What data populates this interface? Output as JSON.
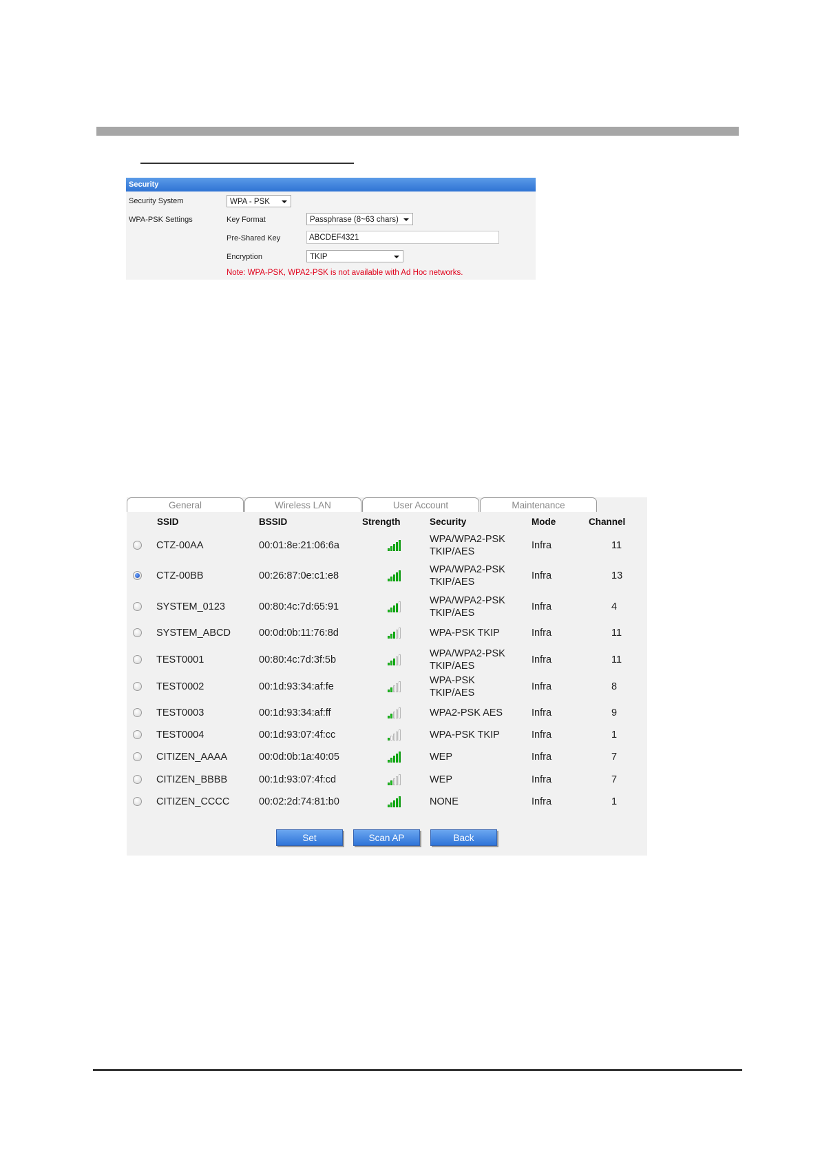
{
  "security": {
    "header": "Security",
    "security_system_label": "Security System",
    "security_system_value": "WPA - PSK",
    "wpa_psk_settings_label": "WPA-PSK Settings",
    "key_format_label": "Key Format",
    "key_format_value": "Passphrase (8~63 chars)",
    "pre_shared_key_label": "Pre-Shared Key",
    "pre_shared_key_value": "ABCDEF4321",
    "encryption_label": "Encryption",
    "encryption_value": "TKIP",
    "note": "Note: WPA-PSK, WPA2-PSK is not available with Ad Hoc networks."
  },
  "tabs": [
    "General",
    "Wireless LAN",
    "User Account",
    "Maintenance"
  ],
  "columns": {
    "ssid": "SSID",
    "bssid": "BSSID",
    "strength": "Strength",
    "security": "Security",
    "mode": "Mode",
    "channel": "Channel"
  },
  "access_points": [
    {
      "ssid": "CTZ-00AA",
      "bssid": "00:01:8e:21:06:6a",
      "strength": 5,
      "security_line1": "WPA/WPA2-PSK",
      "security_line2": "TKIP/AES",
      "mode": "Infra",
      "channel": "11",
      "selected": false
    },
    {
      "ssid": "CTZ-00BB",
      "bssid": "00:26:87:0e:c1:e8",
      "strength": 5,
      "security_line1": "WPA/WPA2-PSK",
      "security_line2": "TKIP/AES",
      "mode": "Infra",
      "channel": "13",
      "selected": true
    },
    {
      "ssid": "SYSTEM_0123",
      "bssid": "00:80:4c:7d:65:91",
      "strength": 4,
      "security_line1": "WPA/WPA2-PSK",
      "security_line2": "TKIP/AES",
      "mode": "Infra",
      "channel": "4",
      "selected": false
    },
    {
      "ssid": "SYSTEM_ABCD",
      "bssid": "00:0d:0b:11:76:8d",
      "strength": 3,
      "security_line1": "WPA-PSK TKIP",
      "security_line2": "",
      "mode": "Infra",
      "channel": "11",
      "selected": false
    },
    {
      "ssid": "TEST0001",
      "bssid": "00:80:4c:7d:3f:5b",
      "strength": 3,
      "security_line1": "WPA/WPA2-PSK",
      "security_line2": "TKIP/AES",
      "mode": "Infra",
      "channel": "11",
      "selected": false
    },
    {
      "ssid": "TEST0002",
      "bssid": "00:1d:93:34:af:fe",
      "strength": 2,
      "security_line1": "WPA-PSK",
      "security_line2": "TKIP/AES",
      "mode": "Infra",
      "channel": "8",
      "selected": false
    },
    {
      "ssid": "TEST0003",
      "bssid": "00:1d:93:34:af:ff",
      "strength": 2,
      "security_line1": "WPA2-PSK AES",
      "security_line2": "",
      "mode": "Infra",
      "channel": "9",
      "selected": false
    },
    {
      "ssid": "TEST0004",
      "bssid": "00:1d:93:07:4f:cc",
      "strength": 1,
      "security_line1": "WPA-PSK TKIP",
      "security_line2": "",
      "mode": "Infra",
      "channel": "1",
      "selected": false
    },
    {
      "ssid": "CITIZEN_AAAA",
      "bssid": "00:0d:0b:1a:40:05",
      "strength": 5,
      "security_line1": "WEP",
      "security_line2": "",
      "mode": "Infra",
      "channel": "7",
      "selected": false
    },
    {
      "ssid": "CITIZEN_BBBB",
      "bssid": "00:1d:93:07:4f:cd",
      "strength": 2,
      "security_line1": "WEP",
      "security_line2": "",
      "mode": "Infra",
      "channel": "7",
      "selected": false
    },
    {
      "ssid": "CITIZEN_CCCC",
      "bssid": "00:02:2d:74:81:b0",
      "strength": 5,
      "security_line1": "NONE",
      "security_line2": "",
      "mode": "Infra",
      "channel": "1",
      "selected": false
    }
  ],
  "buttons": {
    "set": "Set",
    "scan_ap": "Scan AP",
    "back": "Back"
  },
  "colors": {
    "accent": "#2f73d4",
    "note": "#e0001a",
    "signal_on": "#18c21a"
  }
}
